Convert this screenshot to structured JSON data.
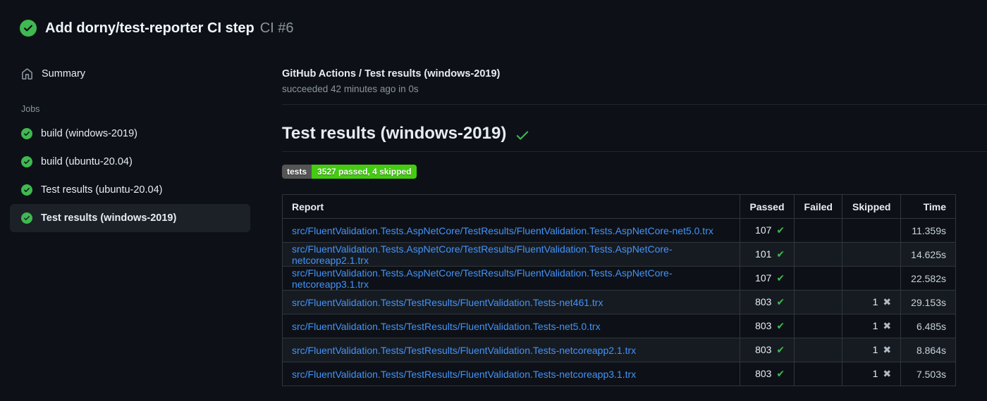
{
  "header": {
    "title": "Add dorny/test-reporter CI step",
    "run_number": "CI #6"
  },
  "sidebar": {
    "summary_label": "Summary",
    "jobs_heading": "Jobs",
    "jobs": [
      {
        "label": "build (windows-2019)",
        "selected": false
      },
      {
        "label": "build (ubuntu-20.04)",
        "selected": false
      },
      {
        "label": "Test results (ubuntu-20.04)",
        "selected": false
      },
      {
        "label": "Test results (windows-2019)",
        "selected": true
      }
    ]
  },
  "main": {
    "job_title": "GitHub Actions / Test results (windows-2019)",
    "job_status": "succeeded 42 minutes ago in 0s",
    "section_heading": "Test results (windows-2019)",
    "badge": {
      "label": "tests",
      "value": "3527 passed, 4 skipped"
    },
    "table": {
      "columns": [
        "Report",
        "Passed",
        "Failed",
        "Skipped",
        "Time"
      ],
      "rows": [
        {
          "report": "src/FluentValidation.Tests.AspNetCore/TestResults/FluentValidation.Tests.AspNetCore-net5.0.trx",
          "passed": "107",
          "failed": "",
          "skipped": "",
          "time": "11.359s"
        },
        {
          "report": "src/FluentValidation.Tests.AspNetCore/TestResults/FluentValidation.Tests.AspNetCore-netcoreapp2.1.trx",
          "passed": "101",
          "failed": "",
          "skipped": "",
          "time": "14.625s"
        },
        {
          "report": "src/FluentValidation.Tests.AspNetCore/TestResults/FluentValidation.Tests.AspNetCore-netcoreapp3.1.trx",
          "passed": "107",
          "failed": "",
          "skipped": "",
          "time": "22.582s"
        },
        {
          "report": "src/FluentValidation.Tests/TestResults/FluentValidation.Tests-net461.trx",
          "passed": "803",
          "failed": "",
          "skipped": "1",
          "time": "29.153s"
        },
        {
          "report": "src/FluentValidation.Tests/TestResults/FluentValidation.Tests-net5.0.trx",
          "passed": "803",
          "failed": "",
          "skipped": "1",
          "time": "6.485s"
        },
        {
          "report": "src/FluentValidation.Tests/TestResults/FluentValidation.Tests-netcoreapp2.1.trx",
          "passed": "803",
          "failed": "",
          "skipped": "1",
          "time": "8.864s"
        },
        {
          "report": "src/FluentValidation.Tests/TestResults/FluentValidation.Tests-netcoreapp3.1.trx",
          "passed": "803",
          "failed": "",
          "skipped": "1",
          "time": "7.503s"
        }
      ]
    }
  },
  "icons": {
    "status": "check-circle-icon",
    "summary": "home-icon",
    "pass_glyph": "✔",
    "skip_glyph": "✖"
  },
  "colors": {
    "background": "#0d1117",
    "row_alt": "#161b22",
    "border": "#30363d",
    "divider": "#21262d",
    "text": "#e6edf3",
    "muted": "#8b949e",
    "link": "#4493f8",
    "success_green": "#3fb950",
    "badge_label_bg": "#555555",
    "badge_value_bg": "#44cc11",
    "selected_item_bg": "#1c2128"
  }
}
